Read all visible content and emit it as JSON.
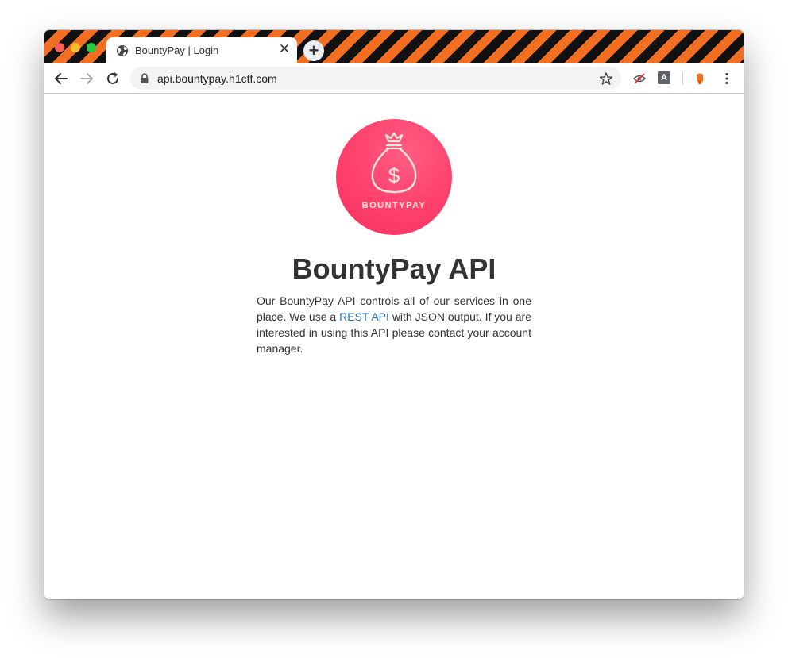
{
  "tab": {
    "title": "BountyPay | Login",
    "close_glyph": "✕"
  },
  "newtab": {
    "glyph": "+"
  },
  "omnibox": {
    "url": "api.bountypay.h1ctf.com"
  },
  "extensions": {
    "translate_letter": "A"
  },
  "page": {
    "logo_text": "BOUNTYPAY",
    "title": "BountyPay API",
    "desc_before": "Our BountyPay API controls all of our services in one place. We use a ",
    "desc_link": "REST API",
    "desc_after": " with JSON output. If you are interested in using this API please contact your account manager."
  },
  "colors": {
    "tabbar_stripe_orange": "#f26f21",
    "tabbar_stripe_black": "#111111",
    "logo_pink": "#ff3f6c",
    "link_blue": "#2a6fb0"
  },
  "icons": [
    "globe-icon",
    "close-icon",
    "plus-icon",
    "back-icon",
    "forward-icon",
    "reload-icon",
    "lock-icon",
    "star-icon",
    "blocked-eye-icon",
    "translate-icon",
    "extension-icon",
    "menu-icon",
    "money-bag-icon"
  ]
}
